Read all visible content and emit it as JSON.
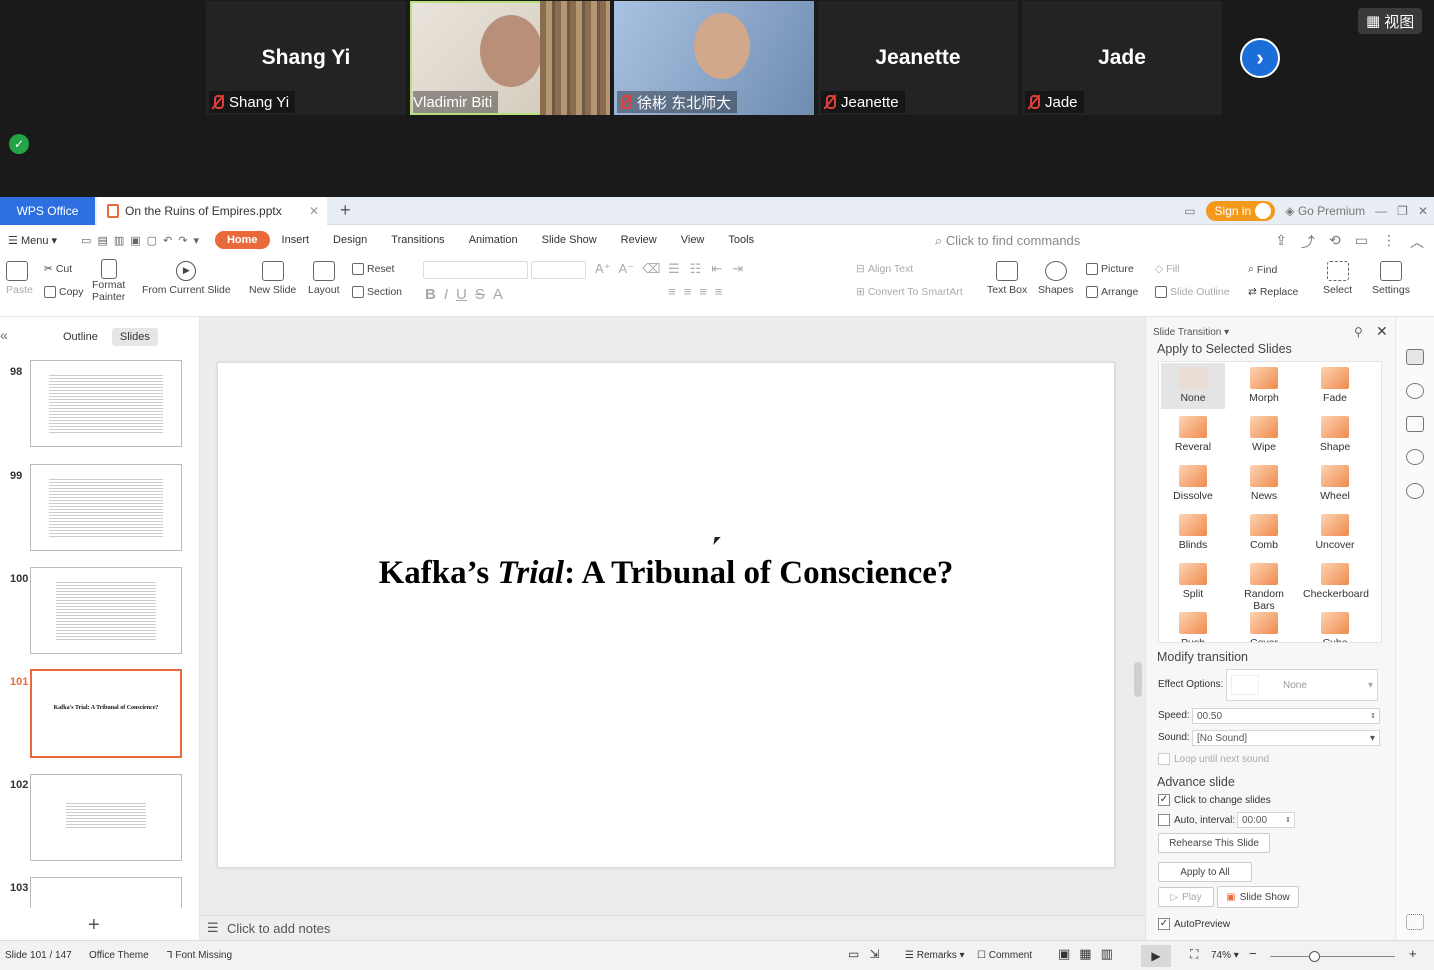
{
  "zoom": {
    "participants": [
      {
        "label": "Shang Yi",
        "big": "Shang Yi",
        "video": false,
        "muted": true
      },
      {
        "label": "Vladimir Biti",
        "big": "",
        "video": true,
        "muted": false
      },
      {
        "label": "徐彬 东北师大",
        "big": "",
        "video": true,
        "muted": true
      },
      {
        "label": "Jeanette",
        "big": "Jeanette",
        "video": false,
        "muted": true
      },
      {
        "label": "Jade",
        "big": "Jade",
        "video": false,
        "muted": true
      }
    ],
    "view_label": "视图",
    "next_icon": "chevron-right-icon"
  },
  "wps": {
    "brand": "WPS Office",
    "doc_tab": "On the Ruins of Empires.pptx",
    "sign_in": "Sign in",
    "go_premium": "Go Premium",
    "menu_label": "Menu",
    "menu_tabs": [
      "Home",
      "Insert",
      "Design",
      "Transitions",
      "Animation",
      "Slide Show",
      "Review",
      "View",
      "Tools"
    ],
    "find_placeholder": "Click to find commands",
    "ribbon": {
      "paste": "Paste",
      "cut": "Cut",
      "copy": "Copy",
      "format_painter_1": "Format",
      "format_painter_2": "Painter",
      "from_current": "From Current Slide",
      "new_slide": "New Slide",
      "layout": "Layout",
      "reset": "Reset",
      "section": "Section",
      "align_text": "Align Text",
      "convert_smartart": "Convert To SmartArt",
      "text_box": "Text Box",
      "shapes": "Shapes",
      "picture": "Picture",
      "arrange": "Arrange",
      "fill": "Fill",
      "slide_outline": "Slide Outline",
      "find": "Find",
      "replace": "Replace",
      "select": "Select",
      "settings": "Settings"
    },
    "left_panel": {
      "tab_outline": "Outline",
      "tab_slides": "Slides",
      "slides": [
        {
          "num": "98",
          "title": "",
          "selected": false
        },
        {
          "num": "99",
          "title": "",
          "selected": false
        },
        {
          "num": "100",
          "title": "",
          "selected": false
        },
        {
          "num": "101",
          "title": "Kafka's Trial: A Tribunal of Conscience?",
          "selected": true
        },
        {
          "num": "102",
          "title": "",
          "selected": false
        },
        {
          "num": "103",
          "title": "",
          "selected": false
        }
      ]
    },
    "slide": {
      "title_a": "Kafka’s ",
      "title_b": "Trial",
      "title_c": ": A Tribunal of Conscience?"
    },
    "notes_placeholder": "Click to add notes",
    "transition_pane": {
      "header": "Slide Transition",
      "apply_selected": "Apply to Selected Slides",
      "effects": [
        "None",
        "Morph",
        "Fade",
        "Reveral",
        "Wipe",
        "Shape",
        "Dissolve",
        "News",
        "Wheel",
        "Blinds",
        "Comb",
        "Uncover",
        "Split",
        "Random Bars",
        "Checkerboard",
        "Push",
        "Cover",
        "Cube"
      ],
      "modify": "Modify transition",
      "effect_options_label": "Effect Options:",
      "effect_options_value": "None",
      "speed_label": "Speed:",
      "speed_value": "00.50",
      "sound_label": "Sound:",
      "sound_value": "[No Sound]",
      "loop_label": "Loop until next sound",
      "advance": "Advance slide",
      "click_change": "Click to change slides",
      "auto_interval": "Auto, interval:",
      "interval_value": "00:00",
      "rehearse": "Rehearse This Slide",
      "apply_all": "Apply to All",
      "play": "Play",
      "slide_show": "Slide Show",
      "autopreview": "AutoPreview"
    },
    "status": {
      "slide_count": "Slide 101 / 147",
      "theme": "Office Theme",
      "font_missing": "Font Missing",
      "remarks": "Remarks",
      "comment": "Comment",
      "zoom": "74%"
    }
  }
}
